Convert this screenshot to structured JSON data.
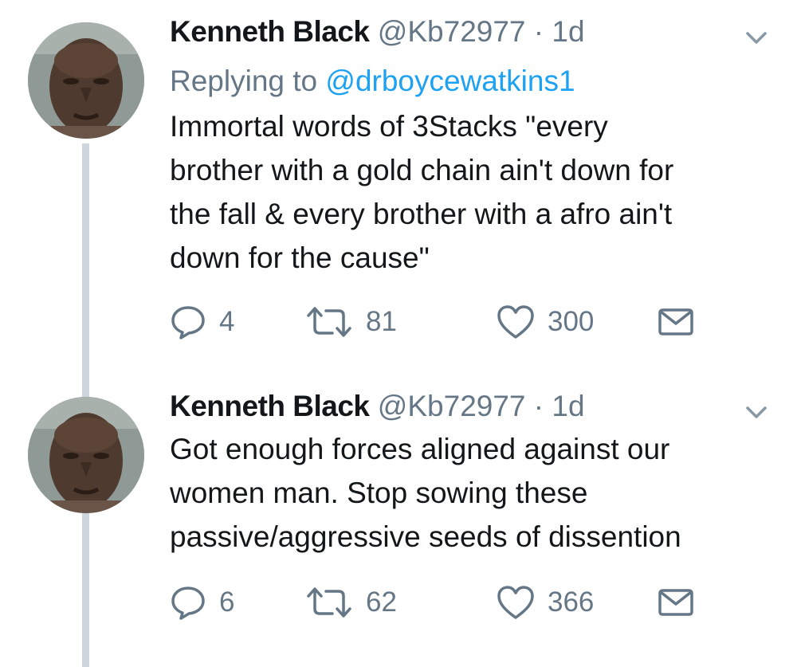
{
  "tweets": [
    {
      "author_name": "Kenneth Black",
      "handle": "@Kb72977",
      "separator": "·",
      "time": "1d",
      "replying_prefix": "Replying to",
      "replying_handle": "@drboycewatkins1",
      "text": "Immortal words of 3Stacks \"every\nbrother with a gold chain ain't down for\nthe fall & every brother with a afro ain't\ndown for the cause\"",
      "replies": "4",
      "retweets": "81",
      "likes": "300"
    },
    {
      "author_name": "Kenneth Black",
      "handle": "@Kb72977",
      "separator": "·",
      "time": "1d",
      "text": "Got enough forces aligned against our\nwomen man. Stop sowing these\npassive/aggressive seeds of dissention",
      "replies": "6",
      "retweets": "62",
      "likes": "366"
    }
  ],
  "colors": {
    "name": "#14171a",
    "secondary": "#657786",
    "link": "#1da1f2",
    "thread_line": "#cdd6dd"
  },
  "icons": [
    "avatar",
    "chevron-down-icon",
    "reply-icon",
    "retweet-icon",
    "like-icon",
    "direct-message-icon"
  ]
}
